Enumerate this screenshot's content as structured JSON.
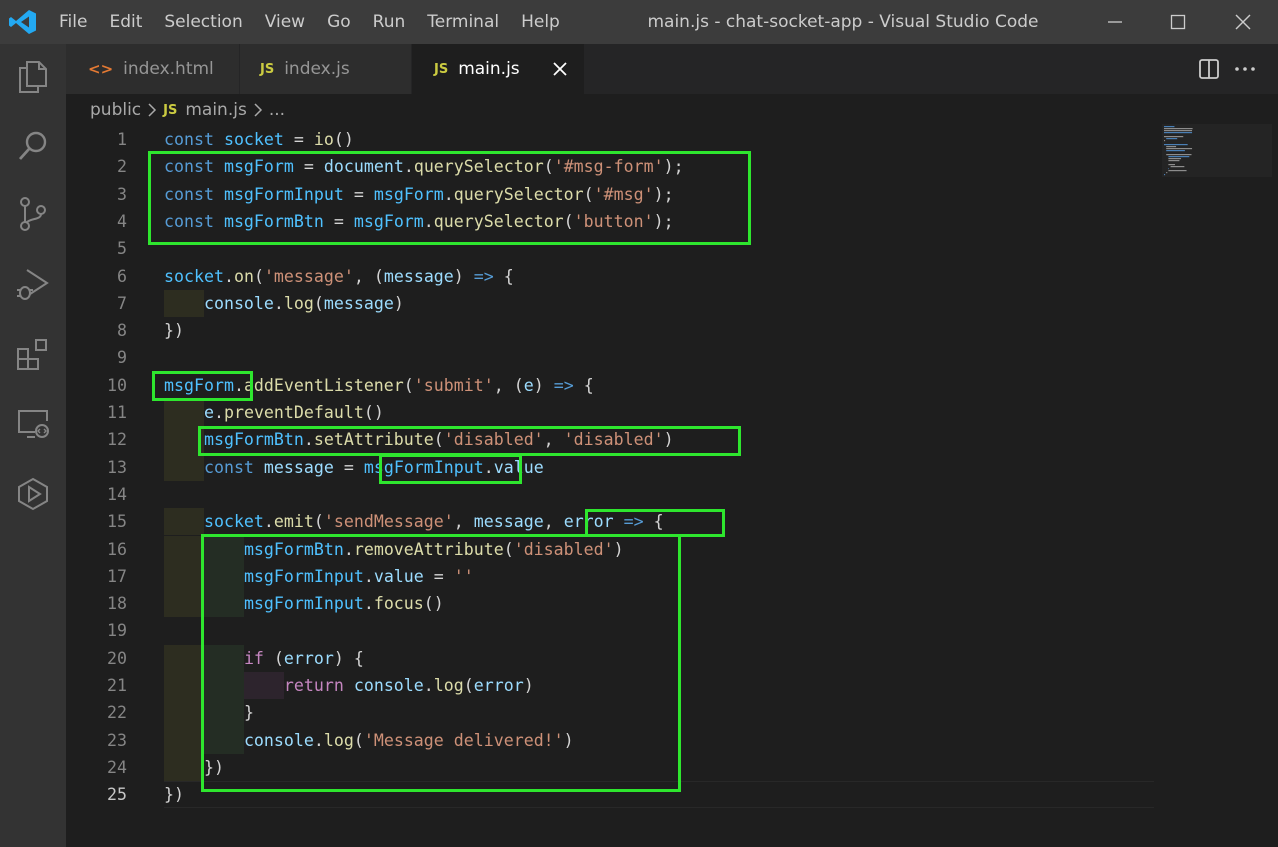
{
  "window": {
    "title": "main.js - chat-socket-app - Visual Studio Code",
    "menu": [
      "File",
      "Edit",
      "Selection",
      "View",
      "Go",
      "Run",
      "Terminal",
      "Help"
    ]
  },
  "activity_bar": {
    "icons": [
      "explorer-icon",
      "search-icon",
      "source-control-icon",
      "run-debug-icon",
      "extensions-icon",
      "remote-explorer-icon",
      "live-share-icon"
    ]
  },
  "tabs": [
    {
      "label": "index.html",
      "icon": "html-file-icon",
      "icon_text": "<>",
      "active": false
    },
    {
      "label": "index.js",
      "icon": "js-file-icon",
      "icon_text": "JS",
      "active": false
    },
    {
      "label": "main.js",
      "icon": "js-file-icon",
      "icon_text": "JS",
      "active": true
    }
  ],
  "breadcrumb": {
    "folder": "public",
    "file_badge": "JS",
    "file": "main.js",
    "more": "..."
  },
  "editor": {
    "current_line": 25,
    "lines": [
      {
        "n": "1",
        "text": "const socket = io()"
      },
      {
        "n": "2",
        "text": "const msgForm = document.querySelector('#msg-form');"
      },
      {
        "n": "3",
        "text": "const msgFormInput = msgForm.querySelector('#msg');"
      },
      {
        "n": "4",
        "text": "const msgFormBtn = msgForm.querySelector('button');"
      },
      {
        "n": "5",
        "text": ""
      },
      {
        "n": "6",
        "text": "socket.on('message', (message) => {"
      },
      {
        "n": "7",
        "text": "    console.log(message)"
      },
      {
        "n": "8",
        "text": "})"
      },
      {
        "n": "9",
        "text": ""
      },
      {
        "n": "10",
        "text": "msgForm.addEventListener('submit', (e) => {"
      },
      {
        "n": "11",
        "text": "    e.preventDefault()"
      },
      {
        "n": "12",
        "text": "    msgFormBtn.setAttribute('disabled', 'disabled')"
      },
      {
        "n": "13",
        "text": "    const message = msgFormInput.value"
      },
      {
        "n": "14",
        "text": ""
      },
      {
        "n": "15",
        "text": "    socket.emit('sendMessage', message, error => {"
      },
      {
        "n": "16",
        "text": "        msgFormBtn.removeAttribute('disabled')"
      },
      {
        "n": "17",
        "text": "        msgFormInput.value = ''"
      },
      {
        "n": "18",
        "text": "        msgFormInput.focus()"
      },
      {
        "n": "19",
        "text": ""
      },
      {
        "n": "20",
        "text": "        if (error) {"
      },
      {
        "n": "21",
        "text": "            return console.log(error)"
      },
      {
        "n": "22",
        "text": "        }"
      },
      {
        "n": "23",
        "text": "        console.log('Message delivered!')"
      },
      {
        "n": "24",
        "text": "    })"
      },
      {
        "n": "25",
        "text": "})"
      }
    ]
  },
  "colors": {
    "highlight_box": "#2ee62e",
    "keyword": "#569cd6",
    "variable": "#9cdcfe",
    "constant": "#4fc1ff",
    "function": "#dcdcaa",
    "string": "#ce9178",
    "control": "#c586c0",
    "vscode_blue": "#23a9f2"
  }
}
